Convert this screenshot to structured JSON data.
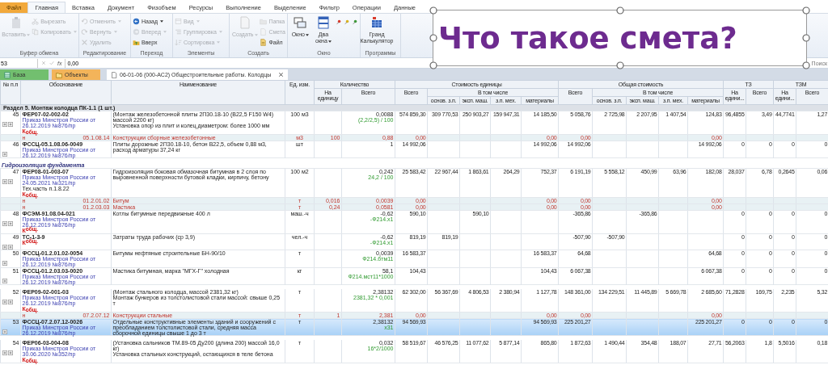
{
  "menu_tabs": [
    {
      "label": "Файл",
      "kind": "file",
      "selected": false
    },
    {
      "label": "Главная",
      "kind": "tab",
      "selected": true
    },
    {
      "label": "Вставка",
      "kind": "tab",
      "selected": false
    },
    {
      "label": "Документ",
      "kind": "tab",
      "selected": false
    },
    {
      "label": "Физобъем",
      "kind": "tab",
      "selected": false
    },
    {
      "label": "Ресурсы",
      "kind": "tab",
      "selected": false
    },
    {
      "label": "Выполнение",
      "kind": "tab",
      "selected": false
    },
    {
      "label": "Выделение",
      "kind": "tab",
      "selected": false
    },
    {
      "label": "Фильтр",
      "kind": "tab",
      "selected": false
    },
    {
      "label": "Операции",
      "kind": "tab",
      "selected": false
    },
    {
      "label": "Данные",
      "kind": "tab",
      "selected": false
    }
  ],
  "ribbon": [
    {
      "label": "Буфер обмена",
      "items": [
        {
          "kind": "large",
          "label": "Вставить",
          "disabled": true,
          "dropdown": true
        },
        {
          "kind": "small",
          "label": "Вырезать",
          "disabled": true,
          "dropdown": false
        },
        {
          "kind": "small",
          "label": "Копировать",
          "disabled": true,
          "dropdown": true
        }
      ]
    },
    {
      "label": "Редактирование",
      "items": [
        {
          "kind": "small",
          "label": "Отменить",
          "disabled": true,
          "dropdown": true
        },
        {
          "kind": "small",
          "label": "Вернуть",
          "disabled": true,
          "dropdown": true
        },
        {
          "kind": "small",
          "label": "Удалить",
          "disabled": true,
          "dropdown": false
        }
      ]
    },
    {
      "label": "Переход",
      "items": [
        {
          "kind": "small",
          "label": "Назад",
          "disabled": false,
          "dropdown": true
        },
        {
          "kind": "small",
          "label": "Вперед",
          "disabled": true,
          "dropdown": true
        },
        {
          "kind": "small",
          "label": "Вверх",
          "disabled": false,
          "dropdown": false
        }
      ]
    },
    {
      "label": "Элементы",
      "items": [
        {
          "kind": "small",
          "label": "Вид",
          "disabled": true,
          "dropdown": true
        },
        {
          "kind": "small",
          "label": "Группировка",
          "disabled": true,
          "dropdown": true
        },
        {
          "kind": "small",
          "label": "Сортировка",
          "disabled": true,
          "dropdown": true
        }
      ]
    },
    {
      "label": "Создать",
      "items": [
        {
          "kind": "large",
          "label": "Создать",
          "disabled": true,
          "dropdown": true
        },
        {
          "kind": "small",
          "label": "Папка",
          "disabled": true,
          "dropdown": false
        },
        {
          "kind": "small",
          "label": "Смета",
          "disabled": true,
          "dropdown": false
        },
        {
          "kind": "small",
          "label": "Файл",
          "disabled": false,
          "dropdown": false
        }
      ]
    },
    {
      "label": "Окно",
      "items": [
        {
          "kind": "large",
          "label": "Окно",
          "disabled": false,
          "dropdown": true
        },
        {
          "kind": "large",
          "label": "Два окна",
          "disabled": false,
          "dropdown": true
        },
        {
          "kind": "pin",
          "color": "#d93a2b"
        },
        {
          "kind": "pin",
          "color": "#d9b21f"
        },
        {
          "kind": "pin",
          "color": "#3f9a3a"
        }
      ]
    },
    {
      "label": "Программы",
      "items": [
        {
          "kind": "large",
          "label": "Гранд Калькулятор",
          "disabled": false,
          "dropdown": false
        }
      ]
    }
  ],
  "formula_bar": {
    "cell": "53",
    "fx": "fx",
    "value": "0,00",
    "search": "Поиск"
  },
  "doc_tabs": [
    {
      "label": "База",
      "kind": "base",
      "selected": false
    },
    {
      "label": "Объекты",
      "kind": "objects",
      "selected": false
    },
    {
      "label": "06-01-06 (000-АС2) Общестроительные работы. Колодцы",
      "kind": "document",
      "selected": true
    }
  ],
  "table": {
    "columns": [
      {
        "label": "№ п.п"
      },
      {
        "label": "Обоснование"
      },
      {
        "label": "Наименование"
      },
      {
        "label": "Ед. изм."
      },
      {
        "label": "Количество",
        "sub": [
          {
            "label": "На единицу"
          },
          {
            "label": "Всего"
          }
        ]
      },
      {
        "label": "Стоимость единицы",
        "sub": [
          {
            "label": "Всего"
          },
          {
            "label": "В том числе",
            "sub": [
              {
                "label": "основ. з.п."
              },
              {
                "label": "эксп. маш."
              },
              {
                "label": "з.п. мех."
              },
              {
                "label": "материалы"
              }
            ]
          }
        ]
      },
      {
        "label": "Общая стоимость",
        "sub": [
          {
            "label": "Всего"
          },
          {
            "label": "В том числе",
            "sub": [
              {
                "label": "основ. з.п."
              },
              {
                "label": "эксп. маш."
              },
              {
                "label": "з.п. мех."
              },
              {
                "label": "материалы"
              }
            ]
          }
        ]
      },
      {
        "label": "ТЗ",
        "sub": [
          {
            "label": "На едини..."
          },
          {
            "label": "Всего"
          }
        ]
      },
      {
        "label": "ТЗМ",
        "sub": [
          {
            "label": "На едини..."
          },
          {
            "label": "Всего"
          }
        ]
      }
    ],
    "rows": [
      {
        "kind": "section",
        "title": "Раздел 5. Монтаж колодца ПК-1.1 (1 шт.)"
      },
      {
        "kind": "item",
        "selected": false,
        "gap_after": false,
        "num": "45",
        "code": "ФЕР07-02-002-02",
        "order": "Приказ Минстроя России от 26.12.2019 №876/пр",
        "koef": "К$_{общ.}$",
        "name": "(Монтаж железобетонной плиты 2П30.18-10 (В22,5 F150 W4) массой 2200 кг)\nУстановка опор из плит и колец диаметром: более 1000 мм",
        "unit": "100 м3",
        "total": "0,0088",
        "formula": "(2,2/2,5) / 100",
        "unit_cost": "574 859,30",
        "unit_wages": "309 770,53",
        "unit_machines": "250 903,27",
        "unit_machine_wages": "159 947,31",
        "unit_materials": "14 185,50",
        "total_cost": "5 058,76",
        "total_wages": "2 725,98",
        "total_machines": "2 207,95",
        "total_machine_wages": "1 407,54",
        "total_materials": "124,83",
        "labor_per_unit": "96,4855",
        "labor_total": "3,49",
        "machine_labor_per_unit": "44,7741",
        "machine_labor_total": "1,27"
      },
      {
        "kind": "resource",
        "marker": "н",
        "code": "05.1.08.14",
        "name": "Конструкции сборные железобетонные",
        "unit": "м3",
        "per_unit": "100",
        "total": "0,88",
        "unit_cost": "0,00",
        "unit_materials": "0,00",
        "total_cost": "0,00",
        "total_materials": "0,00"
      },
      {
        "kind": "item",
        "selected": false,
        "gap_after": true,
        "num": "46",
        "code": "ФССЦ-05.1.08.06-0049",
        "order": "Приказ Минстроя России от 26.12.2019 №876/пр",
        "name": "Плиты дорожные 2П30.18-10, бетон В22,5, объем 0,88 м3, расход арматуры 37,24 кг",
        "unit": "шт",
        "total": "1",
        "unit_cost": "14 992,06",
        "unit_materials": "14 992,06",
        "total_cost": "14 992,06",
        "total_materials": "14 992,06",
        "labor_per_unit": "0",
        "labor_total": "0",
        "machine_labor_per_unit": "0",
        "machine_labor_total": "0"
      },
      {
        "kind": "subsection",
        "title": "Гидроизоляция фундамента"
      },
      {
        "kind": "item",
        "selected": false,
        "gap_after": false,
        "num": "47",
        "code": "ФЕР08-01-003-07",
        "order": "Приказ Минстроя России от 24.05.2021 №321/пр",
        "note": "Тех.часть п.1.8.22",
        "koef": "К$_{общ.}$",
        "name": "Гидроизоляция боковая обмазочная битумная в 2 слоя по выровненной поверхности бутовой кладки, кирпичу, бетону",
        "unit": "100 м2",
        "total": "0,242",
        "formula": "24,2 / 100",
        "unit_cost": "25 583,42",
        "unit_wages": "22 967,44",
        "unit_machines": "1 863,61",
        "unit_machine_wages": "264,29",
        "unit_materials": "752,37",
        "total_cost": "6 191,19",
        "total_wages": "5 558,12",
        "total_machines": "450,99",
        "total_machine_wages": "63,96",
        "total_materials": "182,08",
        "labor_per_unit": "28,037",
        "labor_total": "6,78",
        "machine_labor_per_unit": "0,2645",
        "machine_labor_total": "0,06"
      },
      {
        "kind": "resource",
        "marker": "н",
        "code": "01.2.01.02",
        "name": "Битум",
        "unit": "т",
        "per_unit": "0,016",
        "total": "0,0039",
        "unit_cost": "0,00",
        "unit_materials": "0,00",
        "total_cost": "0,00",
        "total_materials": "0,00"
      },
      {
        "kind": "resource",
        "marker": "н",
        "code": "01.2.03.03",
        "name": "Мастика",
        "unit": "т",
        "per_unit": "0,24",
        "total": "0,0581",
        "unit_cost": "0,00",
        "unit_materials": "0,00",
        "total_cost": "0,00",
        "total_materials": "0,00"
      },
      {
        "kind": "item",
        "selected": false,
        "gap_after": false,
        "num": "48",
        "code": "ФСЭМ-91.08.04-021",
        "order": "Приказ Минстроя России от 26.12.2019 №876/пр",
        "koef": "К$^{общ.}$",
        "name": "Котлы битумные передвижные 400 л",
        "unit": "маш.-ч",
        "total": "-0,62",
        "formula": "-Ф214.х1",
        "unit_cost": "590,10",
        "unit_machines": "590,10",
        "total_cost": "-365,86",
        "total_machines": "-365,86",
        "labor_per_unit": "0",
        "labor_total": "0",
        "machine_labor_per_unit": "0",
        "machine_labor_total": "0"
      },
      {
        "kind": "item",
        "selected": false,
        "gap_after": false,
        "num": "49",
        "code": "ТС-1-3-9",
        "koef": "К$^{общ.}$",
        "name": "Затраты труда рабочих (ср 3,9)",
        "unit": "чел.-ч",
        "total": "-0,62",
        "formula": "-Ф214.х1",
        "unit_cost": "819,19",
        "unit_wages": "819,19",
        "total_cost": "-507,90",
        "total_wages": "-507,90",
        "labor_per_unit": "0",
        "labor_total": "0",
        "machine_labor_per_unit": "0",
        "machine_labor_total": "0"
      },
      {
        "kind": "item",
        "selected": false,
        "gap_after": false,
        "num": "50",
        "code": "ФССЦ-01.2.01.02-0054",
        "order": "Приказ Минстроя России от 26.12.2019 №876/пр",
        "name": "Битумы нефтяные строительные БН-90/10",
        "unit": "т",
        "total": "0,0039",
        "formula": "Ф214.бтм11",
        "unit_cost": "16 583,37",
        "unit_materials": "16 583,37",
        "total_cost": "64,68",
        "total_materials": "64,68",
        "labor_per_unit": "0",
        "labor_total": "0",
        "machine_labor_per_unit": "0",
        "machine_labor_total": "0"
      },
      {
        "kind": "item",
        "selected": false,
        "gap_after": true,
        "num": "51",
        "code": "ФССЦ-01.2.03.03-0020",
        "order": "Приказ Минстроя России от 26.12.2019 №876/пр",
        "name": "Мастика битумная, марка \"МГХ-Г\" холодная",
        "unit": "кг",
        "total": "58,1",
        "formula": "Ф214.мст11*1000",
        "unit_cost": "104,43",
        "unit_materials": "104,43",
        "total_cost": "6 067,38",
        "total_materials": "6 067,38",
        "labor_per_unit": "0",
        "labor_total": "0",
        "machine_labor_per_unit": "0",
        "machine_labor_total": "0"
      },
      {
        "kind": "item",
        "selected": false,
        "gap_after": false,
        "num": "52",
        "code": "ФЕР09-02-001-03",
        "order": "Приказ Минстроя России от 26.12.2019 №876/пр",
        "koef": "К$_{общ.}$",
        "name": "(Монтаж стального колодца, массой 2381,32 кг)\nМонтаж бункеров из толстолистовой стали массой: свыше 0,25 т",
        "unit": "т",
        "total": "2,38132",
        "formula": "2381,32 * 0,001",
        "unit_cost": "62 302,00",
        "unit_wages": "56 367,69",
        "unit_machines": "4 806,53",
        "unit_machine_wages": "2 380,94",
        "unit_materials": "1 127,78",
        "total_cost": "148 361,00",
        "total_wages": "134 229,51",
        "total_machines": "11 445,89",
        "total_machine_wages": "5 669,78",
        "total_materials": "2 685,60",
        "labor_per_unit": "71,2828",
        "labor_total": "169,75",
        "machine_labor_per_unit": "2,235",
        "machine_labor_total": "5,32"
      },
      {
        "kind": "resource",
        "marker": "н",
        "code": "07.2.07.12",
        "name": "Конструкции стальные",
        "unit": "т",
        "per_unit": "1",
        "total": "2,381",
        "unit_cost": "0,00",
        "unit_materials": "0,00",
        "total_cost": "0,00",
        "total_materials": "0,00"
      },
      {
        "kind": "item",
        "selected": true,
        "gap_after": true,
        "num": "53",
        "code": "ФССЦ-07.2.07.12-0026",
        "order": "Приказ Минстроя России от 26.12.2019 №876/пр",
        "name": "Отдельные конструктивные элементы зданий и сооружений с преобладанием толстолистовой стали, средняя масса сборочной единицы свыше 1 до 3 т",
        "unit": "т",
        "total": "2,38132",
        "formula": "х31",
        "unit_cost": "94 569,93",
        "unit_materials": "94 569,93",
        "total_cost": "225 201,27",
        "total_materials": "225 201,27",
        "labor_per_unit": "0",
        "labor_total": "0",
        "machine_labor_per_unit": "0",
        "machine_labor_total": "0"
      },
      {
        "kind": "item",
        "selected": false,
        "gap_after": false,
        "num": "54",
        "code": "ФЕР06-03-004-08",
        "order": "Приказ Минстроя России от 30.06.2020 №352/пр",
        "koef": "К$_{общ.}$",
        "name": "(Установка сальников ТМ.89-05 Ду200 (длина 200) массой 16,0 кг)\nУстановка стальных конструкций, остающихся в теле бетона",
        "unit": "т",
        "total": "0,032",
        "formula": "16*2/1000",
        "unit_cost": "58 519,67",
        "unit_wages": "46 576,25",
        "unit_machines": "11 077,62",
        "unit_machine_wages": "5 877,14",
        "unit_materials": "865,80",
        "total_cost": "1 872,63",
        "total_wages": "1 490,44",
        "total_machines": "354,48",
        "total_machine_wages": "188,07",
        "total_materials": "27,71",
        "labor_per_unit": "56,2063",
        "labor_total": "1,8",
        "machine_labor_per_unit": "5,5016",
        "machine_labor_total": "0,18"
      }
    ]
  },
  "overlay_caption": {
    "text": "Что такое смета?"
  }
}
